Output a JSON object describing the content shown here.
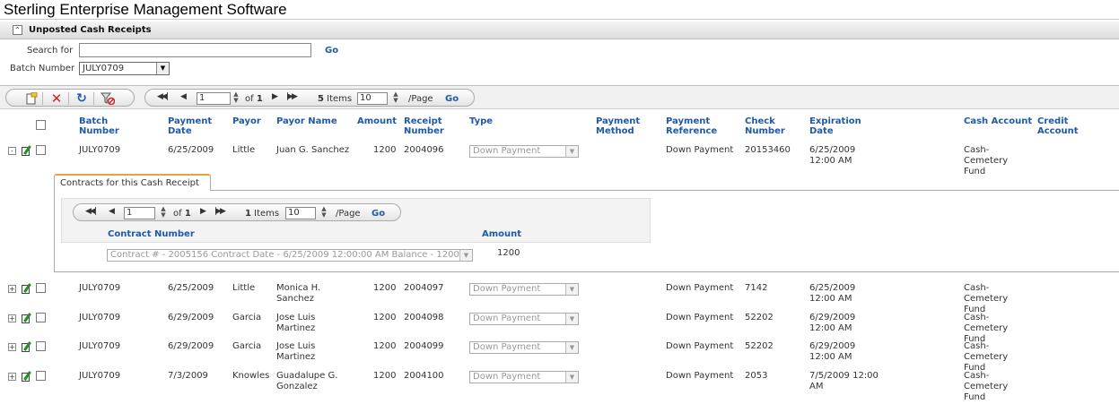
{
  "app": {
    "title": "Sterling Enterprise Management Software"
  },
  "section": {
    "title": "Unposted Cash Receipts"
  },
  "search": {
    "label": "Search for",
    "value": "",
    "go": "Go"
  },
  "batch": {
    "label": "Batch Number",
    "selected": "JULY0709"
  },
  "pager": {
    "page": "1",
    "of_label": "of",
    "total_pages": "1",
    "items_count": "5",
    "items_label": "Items",
    "page_size": "10",
    "page_label": "/Page",
    "go": "Go"
  },
  "columns": [
    {
      "key": "batch",
      "label": "Batch Number"
    },
    {
      "key": "date",
      "label": "Payment Date"
    },
    {
      "key": "payor",
      "label": "Payor"
    },
    {
      "key": "payor_name",
      "label": "Payor Name"
    },
    {
      "key": "amount",
      "label": "Amount"
    },
    {
      "key": "receipt",
      "label": "Receipt Number"
    },
    {
      "key": "type",
      "label": "Type"
    },
    {
      "key": "method",
      "label": "Payment Method"
    },
    {
      "key": "reference",
      "label": "Payment Reference"
    },
    {
      "key": "check",
      "label": "Check Number"
    },
    {
      "key": "expiration",
      "label": "Expiration Date"
    },
    {
      "key": "cash_account",
      "label": "Cash Account"
    },
    {
      "key": "credit_account",
      "label": "Credit Account"
    }
  ],
  "rows": [
    {
      "expand": "-",
      "batch": "JULY0709",
      "date": "6/25/2009",
      "payor": "Little",
      "payor_name": "Juan G. Sanchez",
      "amount": "1200",
      "receipt": "2004096",
      "type": "Down Payment",
      "reference": "Down Payment",
      "check": "20153460",
      "expiration": "6/25/2009 12:00 AM",
      "cash_account": "Cash-Cemetery Fund"
    },
    {
      "expand": "+",
      "batch": "JULY0709",
      "date": "6/25/2009",
      "payor": "Little",
      "payor_name": "Monica H. Sanchez",
      "amount": "1200",
      "receipt": "2004097",
      "type": "Down Payment",
      "reference": "Down Payment",
      "check": "7142",
      "expiration": "6/25/2009 12:00 AM",
      "cash_account": "Cash-Cemetery Fund"
    },
    {
      "expand": "+",
      "batch": "JULY0709",
      "date": "6/29/2009",
      "payor": "Garcia",
      "payor_name": "Jose Luis Martinez",
      "amount": "1200",
      "receipt": "2004098",
      "type": "Down Payment",
      "reference": "Down Payment",
      "check": "52202",
      "expiration": "6/29/2009 12:00 AM",
      "cash_account": "Cash-Cemetery Fund"
    },
    {
      "expand": "+",
      "batch": "JULY0709",
      "date": "6/29/2009",
      "payor": "Garcia",
      "payor_name": "Jose Luis Martinez",
      "amount": "1200",
      "receipt": "2004099",
      "type": "Down Payment",
      "reference": "Down Payment",
      "check": "52202",
      "expiration": "6/29/2009 12:00 AM",
      "cash_account": "Cash-Cemetery Fund"
    },
    {
      "expand": "+",
      "batch": "JULY0709",
      "date": "7/3/2009",
      "payor": "Knowles",
      "payor_name": "Guadalupe G. Gonzalez",
      "amount": "1200",
      "receipt": "2004100",
      "type": "Down Payment",
      "reference": "Down Payment",
      "check": "2053",
      "expiration": "7/5/2009 12:00 AM",
      "cash_account": "Cash-Cemetery Fund"
    }
  ],
  "detail": {
    "tab": "Contracts for this Cash Receipt",
    "pager": {
      "page": "1",
      "of_label": "of",
      "total_pages": "1",
      "items_count": "1",
      "items_label": "Items",
      "page_size": "10",
      "page_label": "/Page",
      "go": "Go"
    },
    "columns": [
      "Contract Number",
      "Amount"
    ],
    "contract": "Contract # - 2005156 Contract Date - 6/25/2009 12:00:00 AM Balance - 1200",
    "amount": "1200"
  },
  "icons": [
    "collapse-icon",
    "new-record-icon",
    "delete-icon",
    "refresh-icon",
    "clear-filter-icon",
    "first-page-icon",
    "prev-page-icon",
    "next-page-icon",
    "last-page-icon",
    "edit-icon"
  ],
  "colors": {
    "header_link": "#1e5aa8",
    "delete_red": "#d42020",
    "active_tab": "#e8a33d"
  }
}
